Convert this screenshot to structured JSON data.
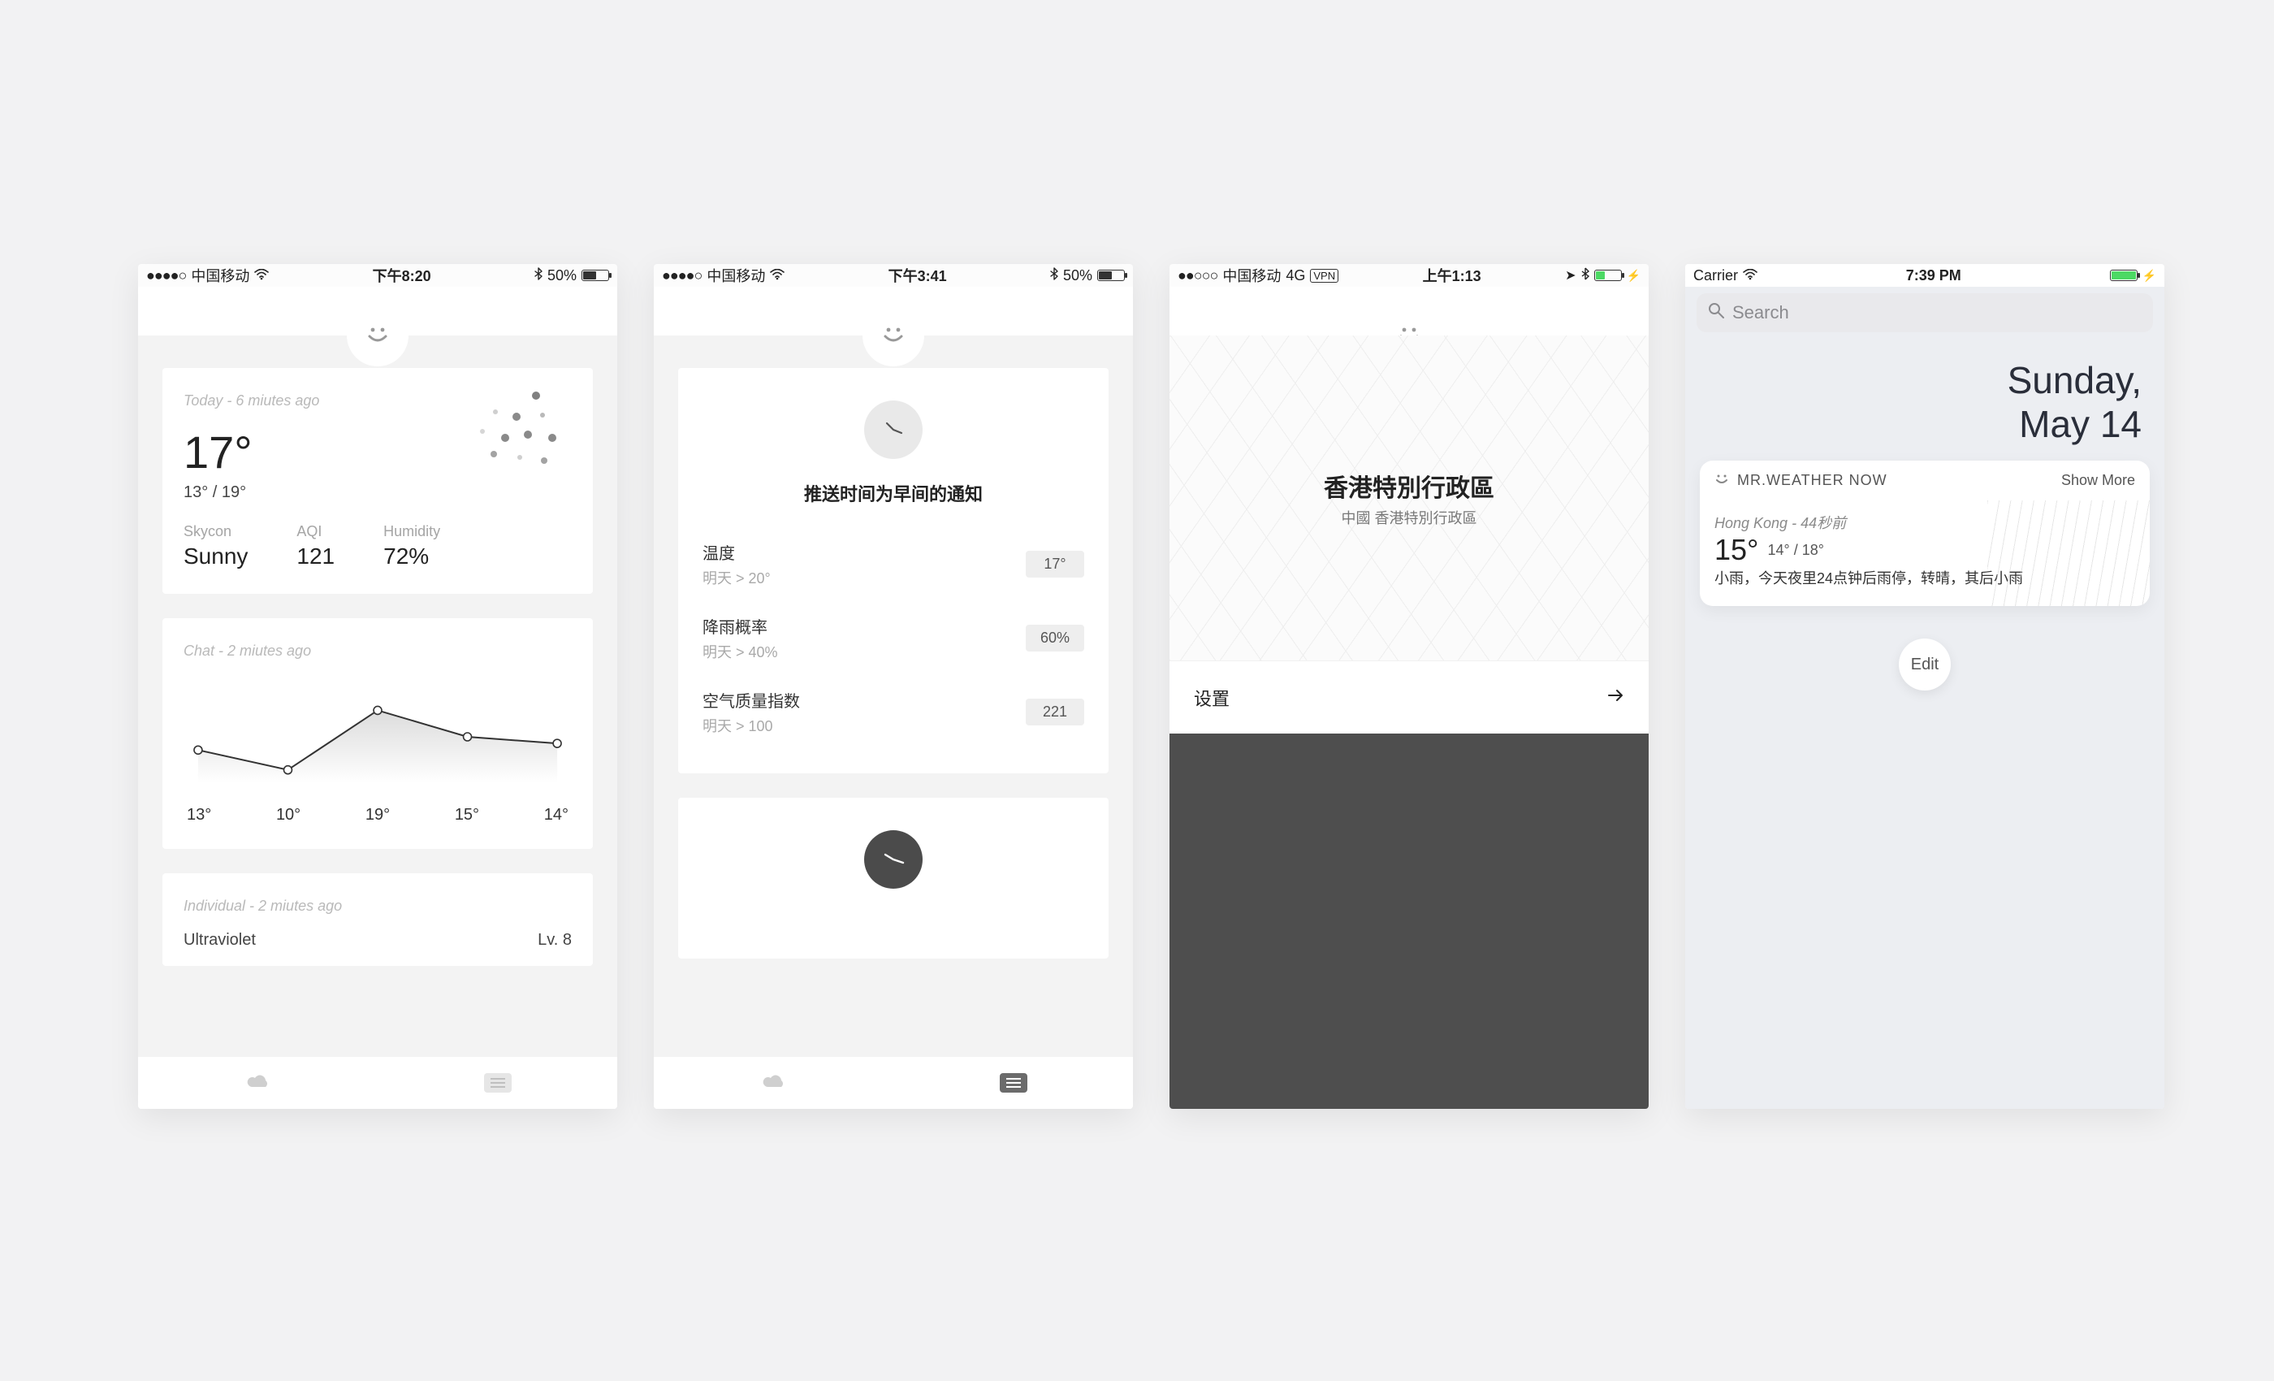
{
  "screen1": {
    "status": {
      "carrier": "中国移动",
      "time": "下午8:20",
      "bt": "50%",
      "signal": "●●●●○",
      "wifi": true
    },
    "today": {
      "subtitle": "Today - 6 miutes ago",
      "temp": "17°",
      "range": "13° / 19°",
      "metrics": {
        "skycon_label": "Skycon",
        "skycon_value": "Sunny",
        "aqi_label": "AQI",
        "aqi_value": "121",
        "humidity_label": "Humidity",
        "humidity_value": "72%"
      }
    },
    "chart": {
      "subtitle": "Chat - 2 miutes ago"
    },
    "individual": {
      "subtitle": "Individual - 2 miutes ago",
      "uv_label": "Ultraviolet",
      "uv_value": "Lv. 8"
    }
  },
  "chart_data": {
    "type": "line",
    "categories": [
      "13°",
      "10°",
      "19°",
      "15°",
      "14°"
    ],
    "values": [
      13,
      10,
      19,
      15,
      14
    ],
    "title": "",
    "xlabel": "",
    "ylabel": "",
    "ylim": [
      8,
      22
    ]
  },
  "screen2": {
    "status": {
      "carrier": "中国移动",
      "time": "下午3:41",
      "bt": "50%",
      "signal": "●●●●○",
      "wifi": true
    },
    "title": "推送时间为早间的通知",
    "rows": [
      {
        "name": "温度",
        "detail": "明天 > 20°",
        "value": "17°"
      },
      {
        "name": "降雨概率",
        "detail": "明天 > 40%",
        "value": "60%"
      },
      {
        "name": "空气质量指数",
        "detail": "明天 > 100",
        "value": "221"
      }
    ]
  },
  "screen3": {
    "status": {
      "carrier": "中国移动",
      "net": "4G",
      "vpn": "VPN",
      "time": "上午1:13"
    },
    "city": "香港特別行政區",
    "subcity": "中國 香港特別行政區",
    "settings_label": "设置"
  },
  "screen4": {
    "status": {
      "carrier": "Carrier",
      "time": "7:39 PM"
    },
    "search_placeholder": "Search",
    "date_line1": "Sunday,",
    "date_line2": "May 14",
    "widget": {
      "app": "MR.WEATHER NOW",
      "showmore": "Show More",
      "location": "Hong Kong - 44秒前",
      "temp": "15°",
      "range": "14° / 18°",
      "desc": "小雨，今天夜里24点钟后雨停，转晴，其后小雨"
    },
    "edit_label": "Edit"
  }
}
